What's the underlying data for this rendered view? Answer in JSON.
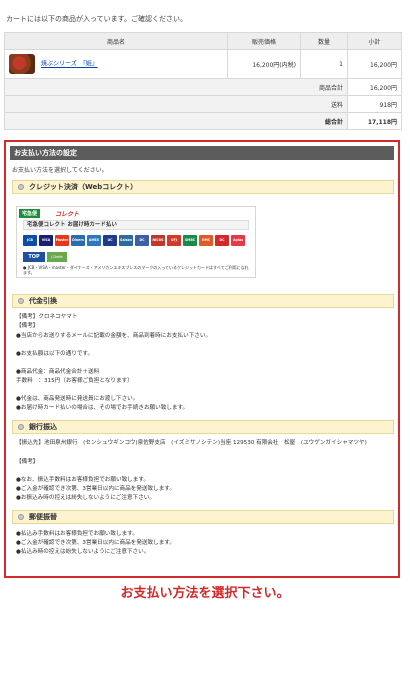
{
  "notice": "カートには以下の商品が入っています。ご確認ください。",
  "cart": {
    "headers": {
      "product": "商品名",
      "price": "販売価格",
      "qty": "数量",
      "subtotal": "小計"
    },
    "item": {
      "name": "焼ぷシリーズ　『姫』",
      "price": "16,200円(内税)",
      "qty": "1",
      "subtotal": "16,200円"
    },
    "summary": [
      {
        "label": "商品合計",
        "value": "16,200円"
      },
      {
        "label": "送料",
        "value": "918円"
      },
      {
        "label": "総合計",
        "value": "17,118円"
      }
    ]
  },
  "payment": {
    "title": "お支払い方法の設定",
    "intro": "お支払い方法を選択してください。",
    "credit": {
      "title": "クレジット決済（Webコレクト）",
      "badge": "宅急便",
      "brand": "コレクト",
      "banner": "宅急便コレクト お届け時カード払い",
      "logos": [
        "JCB",
        "VISA",
        "Master",
        "Diners",
        "AMEX",
        "UC",
        "Saison",
        "DC",
        "NICOS",
        "UFJ",
        "SMBC",
        "OMC",
        "DC",
        "Aplus",
        "Nicos"
      ],
      "top": "TOP",
      "jdebit": "J-Debit",
      "note": "● JCB・VISA・master・ダイナース・アメリカンエキスプレスのマークの入っているクレジットカードはすべてご利用になれます。"
    },
    "cod": {
      "title": "代金引換",
      "lines": [
        "【備考】クロネコヤマト",
        "【備考】",
        "●当店からお送りするメールに記載の金額を、商品到着時にお支払い下さい。",
        "●お支払額は以下の通りです。",
        "●商品代金：商品代金合計＋送料",
        "手数料　：315円（お客様ご負担となります）",
        "●代金は、商品発送時に発送員にお渡し下さい。",
        "●お届け時カード払いの場合は、その場でお手続きお願い致します。"
      ]
    },
    "bank": {
      "title": "銀行振込",
      "account": "【振込先】池田泉州銀行　(センシュウギンコウ)泉佐野支店　(イズミサノシテン)当座 129530 有限会社　松屋　(ユウゲンガイシャマツヤ)",
      "lines": [
        "【備考】",
        "●なお、振込手数料はお客様負担でお願い致します。",
        "●ご入金が確認でき次第、3営業日以内に商品を発送致します。",
        "●お振込み時の控えは紛失しないようにご注意下さい。"
      ]
    },
    "postal": {
      "title": "郵便振替",
      "lines": [
        "●払込み手数料はお客様負担でお願い致します。",
        "●ご入金が確認でき次第、3営業日以内に商品を発送致します。",
        "●払込み時の控えは紛失しないようにご注意下さい。"
      ]
    }
  },
  "prompt": "お支払い方法を選択下さい。",
  "colors": {
    "accent": "#d12a2a",
    "header": "#5c5c5c",
    "section": "#fdf3cf"
  }
}
